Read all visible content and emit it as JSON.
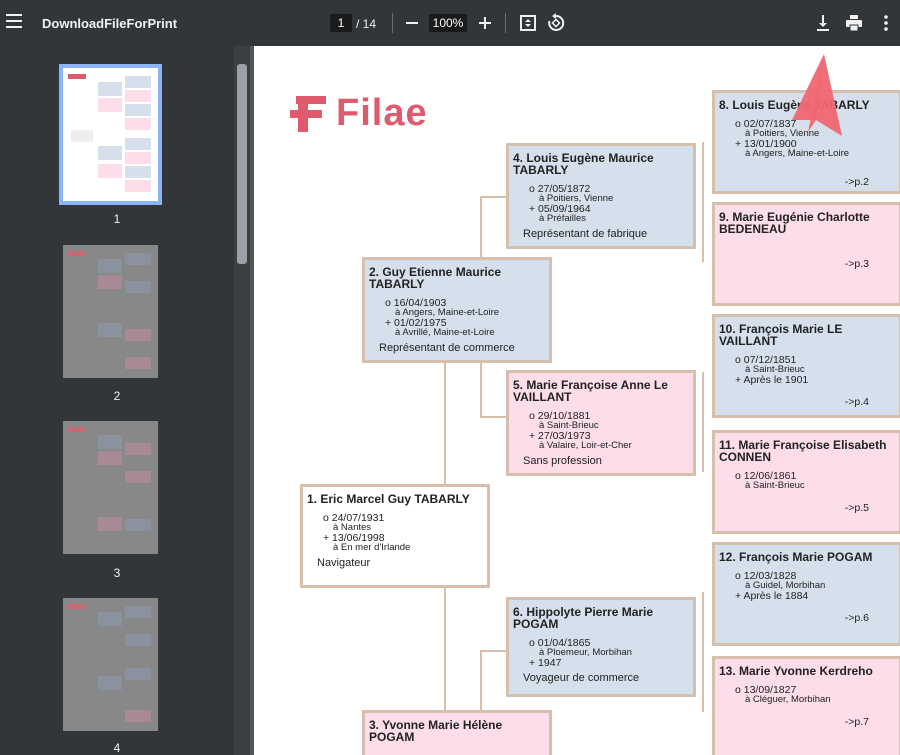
{
  "toolbar": {
    "title": "DownloadFileForPrint",
    "page": "1",
    "total": "/ 14",
    "zoom": "100%"
  },
  "thumbnails": [
    {
      "label": "1"
    },
    {
      "label": "2"
    },
    {
      "label": "3"
    },
    {
      "label": "4"
    }
  ],
  "logo": "Filae",
  "people": [
    {
      "name": "1. Eric Marcel Guy TABARLY",
      "lines": [
        [
          "o 24/07/1931",
          "à Nantes"
        ],
        [
          "+ 13/06/1998",
          "à En mer d'Irlande"
        ]
      ],
      "occ": "Navigateur",
      "ref": ""
    },
    {
      "name": "2. Guy Etienne Maurice TABARLY",
      "lines": [
        [
          "o 16/04/1903",
          "à Angers,  Maine-et-Loire"
        ],
        [
          "+ 01/02/1975",
          "à Avrillé,  Maine-et-Loire"
        ]
      ],
      "occ": "Représentant de commerce",
      "ref": ""
    },
    {
      "name": "3. Yvonne Marie Hélène POGAM",
      "lines": [],
      "occ": "",
      "ref": ""
    },
    {
      "name": "4. Louis Eugène Maurice TABARLY",
      "lines": [
        [
          "o 27/05/1872",
          "à Poitiers,  Vienne"
        ],
        [
          "+ 05/09/1964",
          "à Préfailles"
        ]
      ],
      "occ": "Représentant de fabrique",
      "ref": ""
    },
    {
      "name": "5. Marie Françoise Anne Le VAILLANT",
      "lines": [
        [
          "o 29/10/1881",
          "à Saint-Brieuc"
        ],
        [
          "+ 27/03/1973",
          "à Valaire,  Loir-et-Cher"
        ]
      ],
      "occ": "Sans profession",
      "ref": ""
    },
    {
      "name": "6. Hippolyte Pierre Marie POGAM",
      "lines": [
        [
          "o 01/04/1865",
          "à Ploemeur,  Morbihan"
        ],
        [
          "+ 1947",
          ""
        ]
      ],
      "occ": "Voyageur de commerce",
      "ref": ""
    },
    {
      "name": "8. Louis Eugène TABARLY",
      "lines": [
        [
          "o 02/07/1837",
          "à Poitiers,  Vienne"
        ],
        [
          "+ 13/01/1900",
          "à Angers,  Maine-et-Loire"
        ]
      ],
      "occ": "",
      "ref": "->p.2"
    },
    {
      "name": "9. Marie Eugénie Charlotte BEDENEAU",
      "lines": [],
      "occ": "",
      "ref": "->p.3"
    },
    {
      "name": "10. François Marie LE VAILLANT",
      "lines": [
        [
          "o 07/12/1851",
          "à Saint-Brieuc"
        ],
        [
          "+ Après le 1901",
          ""
        ]
      ],
      "occ": "",
      "ref": "->p.4"
    },
    {
      "name": "11. Marie Françoise Elisabeth CONNEN",
      "lines": [
        [
          "o 12/06/1861",
          "à Saint-Brieuc"
        ]
      ],
      "occ": "",
      "ref": "->p.5"
    },
    {
      "name": "12. François Marie POGAM",
      "lines": [
        [
          "o 12/03/1828",
          "à Guidel,  Morbihan"
        ],
        [
          "+ Après le 1884",
          ""
        ]
      ],
      "occ": "",
      "ref": "->p.6"
    },
    {
      "name": "13. Marie Yvonne Kerdreho",
      "lines": [
        [
          "o 13/09/1827",
          "à Cléguer,  Morbihan"
        ]
      ],
      "occ": "",
      "ref": "->p.7"
    }
  ]
}
